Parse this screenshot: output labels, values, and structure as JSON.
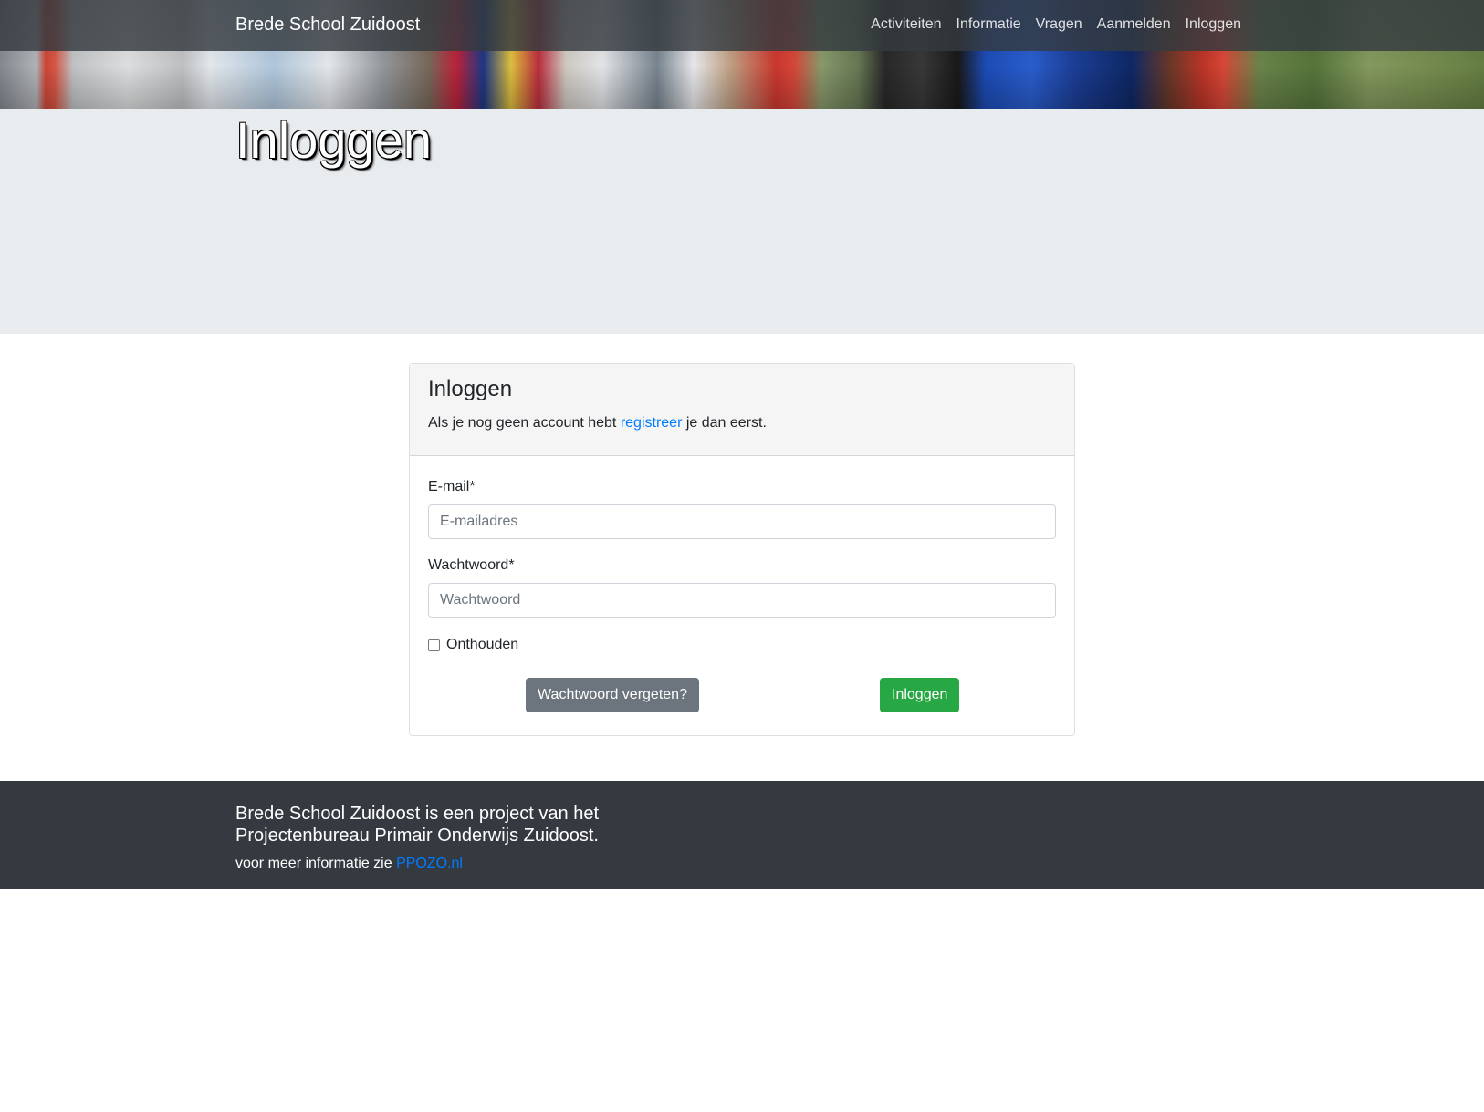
{
  "navbar": {
    "brand": "Brede School Zuidoost",
    "links": [
      "Activiteiten",
      "Informatie",
      "Vragen",
      "Aanmelden",
      "Inloggen"
    ]
  },
  "jumbotron": {
    "title": "Inloggen"
  },
  "login_card": {
    "title": "Inloggen",
    "sub_before": "Als je nog geen account hebt ",
    "sub_link": "registreer",
    "sub_after": " je dan eerst.",
    "email_label": "E-mail*",
    "email_placeholder": "E-mailadres",
    "email_value": "",
    "password_label": "Wachtwoord*",
    "password_placeholder": "Wachtwoord",
    "password_value": "",
    "remember_label": "Onthouden",
    "remember_checked": false,
    "forgot_button": "Wachtwoord vergeten?",
    "login_button": "Inloggen"
  },
  "footer": {
    "title": "Brede School Zuidoost is een project van het Projectenbureau Primair Onderwijs Zuidoost.",
    "more_text": "voor meer informatie zie ",
    "more_link": "PPOZO.nl"
  },
  "colors": {
    "navbar_bg": "#343a40",
    "jumbotron_bg": "#e9ecef",
    "link": "#007bff",
    "secondary": "#6c757d",
    "success": "#28a745",
    "footer_bg": "#343a40"
  }
}
